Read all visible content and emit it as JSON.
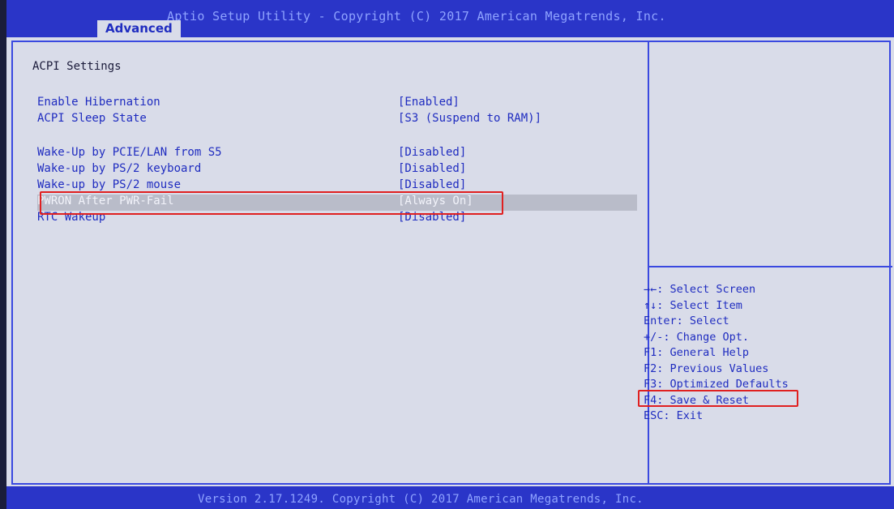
{
  "header": {
    "title": "Aptio Setup Utility - Copyright (C) 2017 American Megatrends, Inc.",
    "active_tab": "Advanced"
  },
  "main": {
    "section_title": "ACPI Settings",
    "rows": [
      {
        "label": "Enable Hibernation",
        "value": "[Enabled]"
      },
      {
        "label": "ACPI Sleep State",
        "value": "[S3 (Suspend to RAM)]"
      },
      {
        "label": "Wake-Up by PCIE/LAN from S5",
        "value": "[Disabled]"
      },
      {
        "label": "Wake-up by PS/2 keyboard",
        "value": "[Disabled]"
      },
      {
        "label": "Wake-up by PS/2 mouse",
        "value": "[Disabled]"
      },
      {
        "label": "PWRON After PWR-Fail",
        "value": "[Always On]"
      },
      {
        "label": "RTC Wakeup",
        "value": "[Disabled]"
      }
    ]
  },
  "help": {
    "items": [
      "→←: Select Screen",
      "↑↓: Select Item",
      "Enter: Select",
      "+/-: Change Opt.",
      "F1: General Help",
      "F2: Previous Values",
      "F3: Optimized Defaults",
      "F4: Save & Reset",
      "ESC: Exit"
    ]
  },
  "footer": {
    "text": "Version 2.17.1249. Copyright (C) 2017 American Megatrends, Inc."
  },
  "colors": {
    "bios_blue": "#2a35c8",
    "panel_bg": "#d9dce9",
    "text_blue": "#1f2cc0",
    "annotation_red": "#e02020"
  }
}
